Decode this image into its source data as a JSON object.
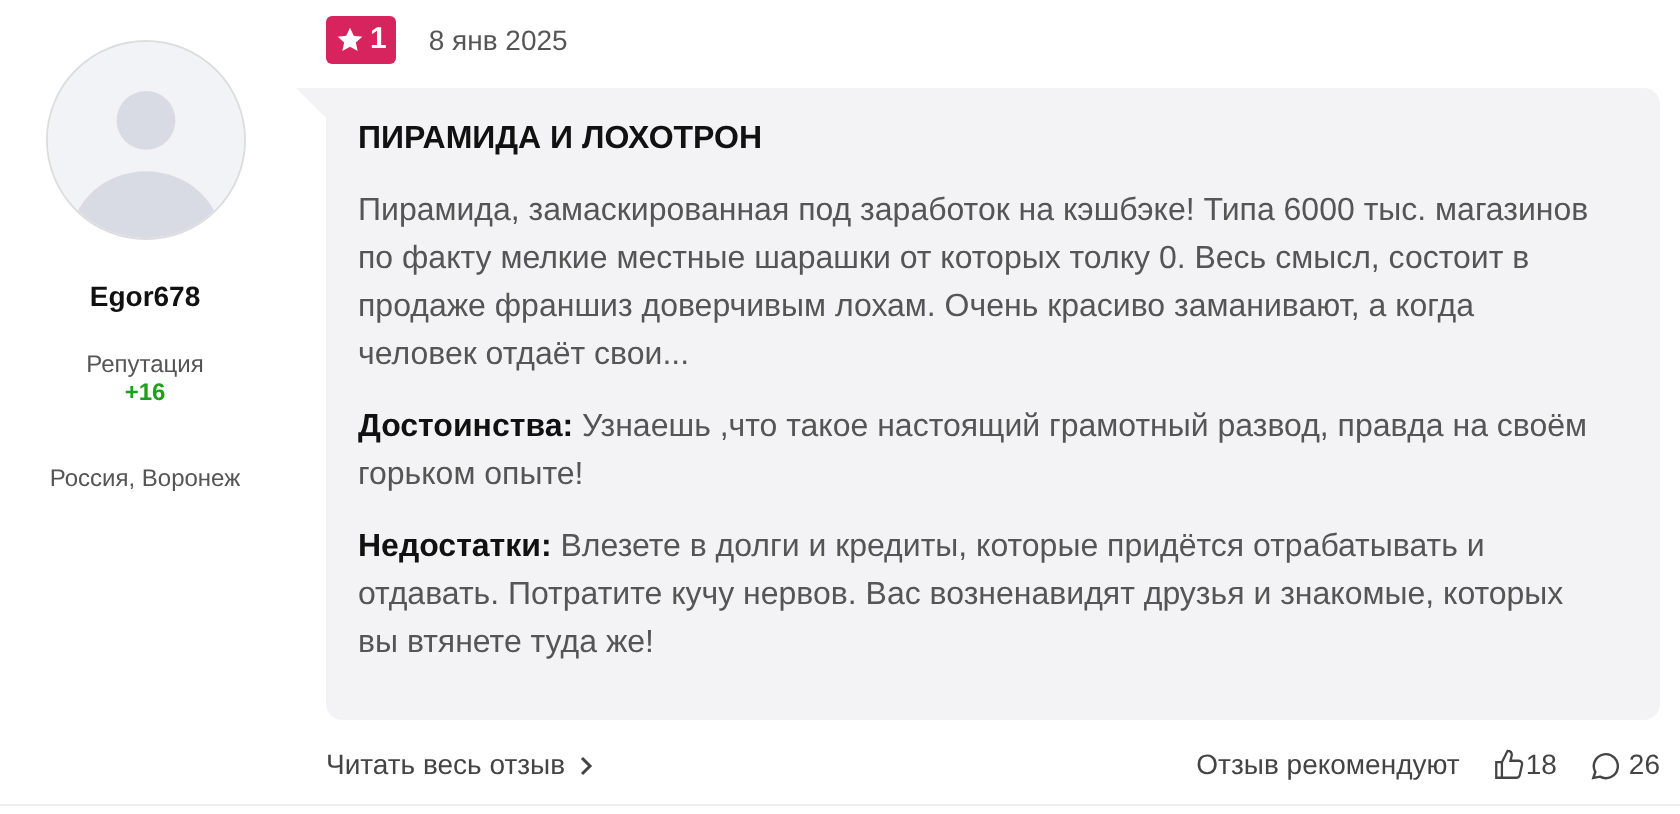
{
  "author": {
    "name": "Egor678",
    "reputation_label": "Репутация",
    "reputation": "+16",
    "location": "Россия, Воронеж"
  },
  "review": {
    "rating": "1",
    "date": "8 янв 2025",
    "title": "ПИРАМИДА И ЛОХОТРОН",
    "text": "Пирамида, замаскированная под заработок на кэшбэке! Типа 6000 тыс. магазинов по факту мелкие местные шарашки от которых толку 0. Весь смысл, состоит в продаже франшиз доверчивым лохам. Очень красиво заманивают, а когда человек отдаёт свои...",
    "sections": [
      {
        "label": "Достоинства:",
        "text": "Узнаешь ,что такое настоящий грамотный развод, правда на своём горьком опыте!"
      },
      {
        "label": "Недостатки:",
        "text": "Влезете в долги и кредиты, которые придётся отрабатывать и отдавать. Потратите кучу нервов. Вас возненавидят друзья и знакомые, которых вы втянете туда же!"
      }
    ]
  },
  "footer": {
    "read_more": "Читать весь отзыв",
    "recommend_label": "Отзыв рекомендуют",
    "likes": "18",
    "comments": "26"
  }
}
